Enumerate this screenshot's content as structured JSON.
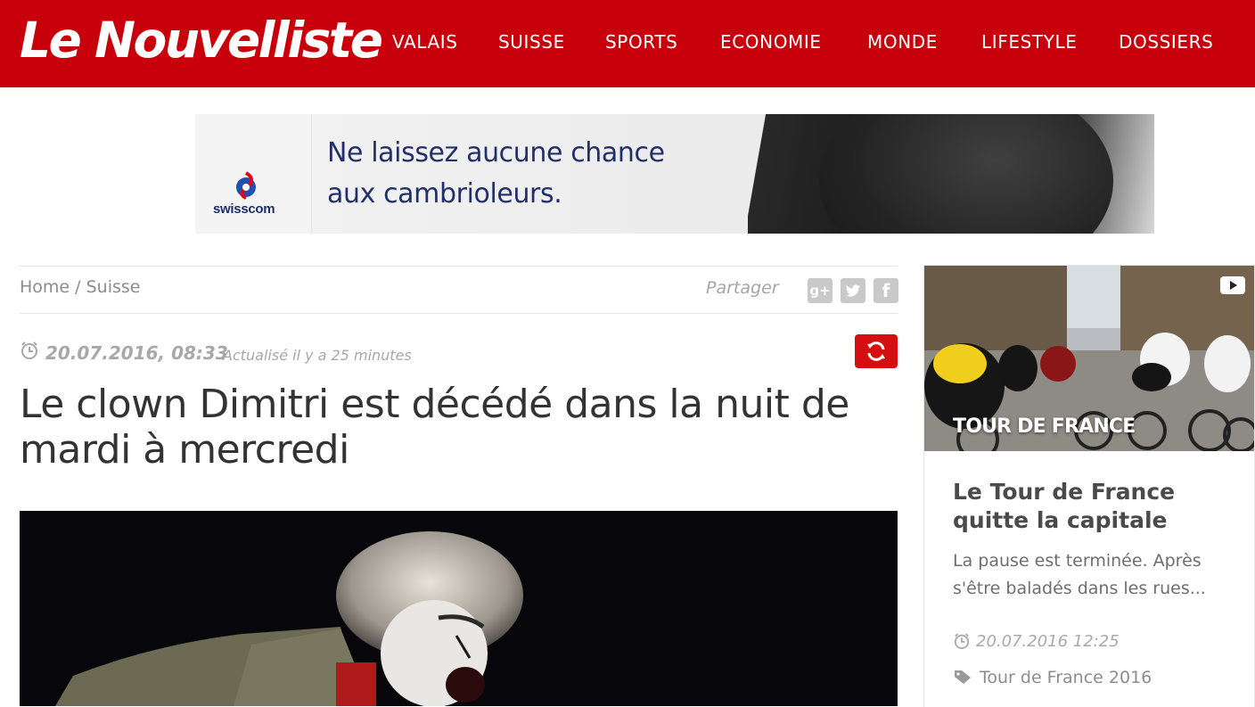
{
  "header": {
    "logo": "Le Nouvelliste",
    "nav": [
      "VALAIS",
      "SUISSE",
      "SPORTS",
      "ECONOMIE",
      "MONDE",
      "LIFESTYLE",
      "DOSSIERS"
    ],
    "brand_color": "#c8000b"
  },
  "ad": {
    "brand": "swisscom",
    "line1": "Ne laissez aucune chance",
    "line2": "aux cambrioleurs."
  },
  "breadcrumb": {
    "home": "Home",
    "separator": "/",
    "section": "Suisse"
  },
  "share": {
    "label": "Partager",
    "icons": [
      "google-plus-icon",
      "twitter-icon",
      "facebook-icon"
    ]
  },
  "article": {
    "date": "20.07.2016, 08:33",
    "updated": "Actualisé il y a 25 minutes",
    "title": "Le clown Dimitri est décédé dans la nuit de mardi à mercredi"
  },
  "sidebar_card": {
    "image_label": "TOUR DE FRANCE",
    "title": "Le Tour de France quitte la capitale",
    "excerpt": "La pause est terminée. Après s'être baladés dans les rues...",
    "date": "20.07.2016 12:25",
    "topic": "Tour de France 2016"
  }
}
